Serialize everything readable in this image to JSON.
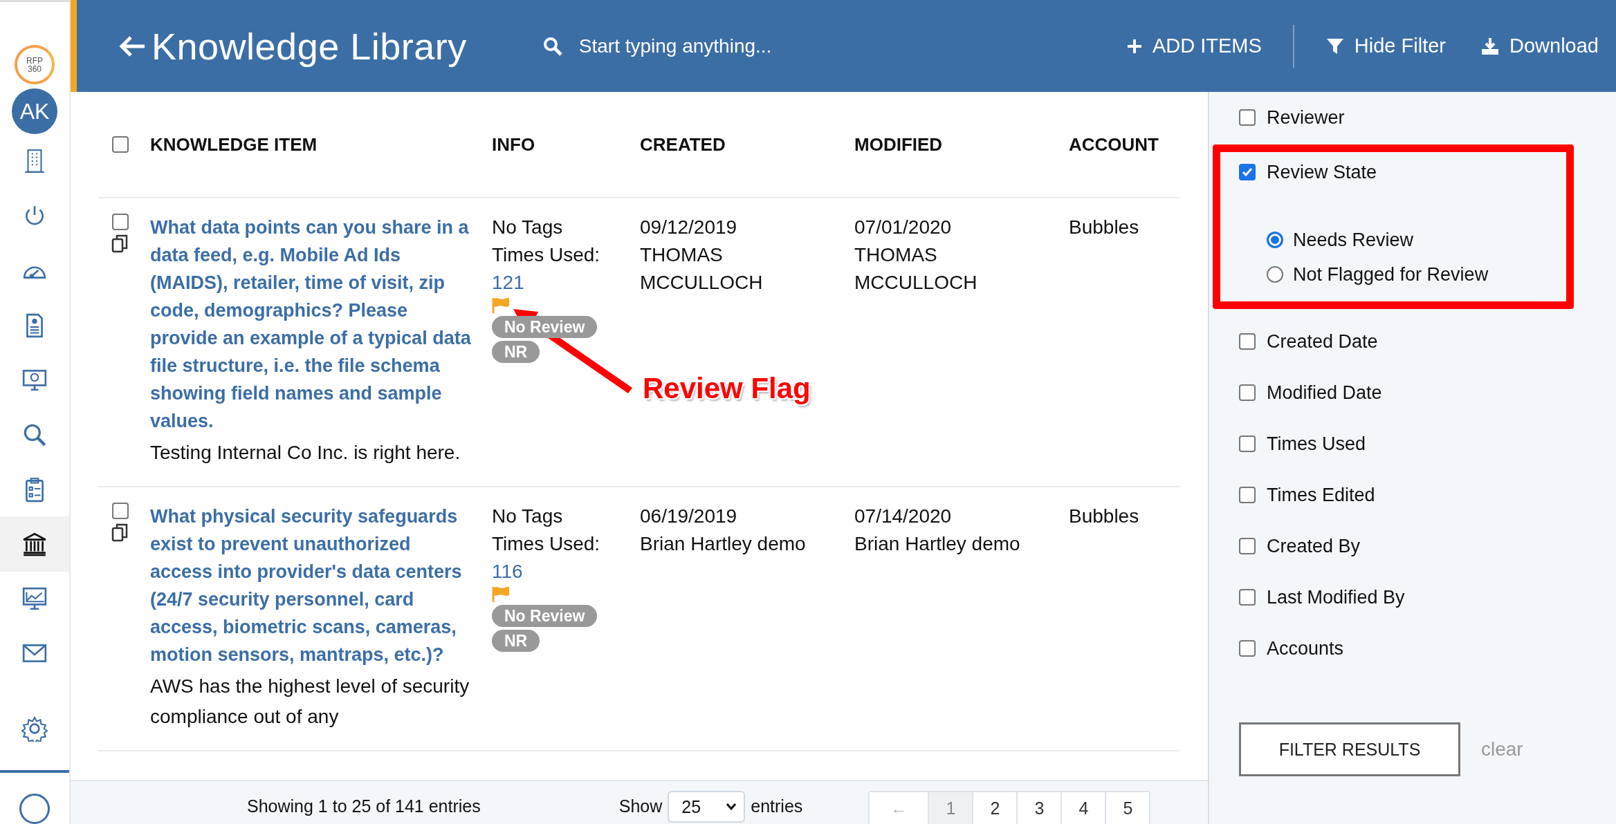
{
  "sidebar": {
    "logo": [
      "RFP",
      "360"
    ],
    "avatar": "AK",
    "items": [
      {
        "selected": false
      },
      {
        "selected": false
      },
      {
        "selected": false
      },
      {
        "selected": false
      },
      {
        "selected": false
      },
      {
        "selected": false
      },
      {
        "selected": false
      },
      {
        "selected": true
      },
      {
        "selected": false
      },
      {
        "selected": false
      },
      {
        "selected": false
      }
    ]
  },
  "header": {
    "title": "Knowledge Library",
    "search": {
      "placeholder": "Start typing anything..."
    },
    "actions": [
      {
        "kind": "add",
        "label": "ADD ITEMS"
      },
      {
        "kind": "filter",
        "label": "Hide Filter"
      },
      {
        "kind": "download",
        "label": "Download"
      }
    ]
  },
  "table": {
    "select_all_checked": false,
    "columns": [
      "KNOWLEDGE ITEM",
      "INFO",
      "CREATED",
      "MODIFIED",
      "ACCOUNT"
    ],
    "rows": [
      {
        "checked": false,
        "question": "What data points can you share in a data feed, e.g. Mobile Ad Ids (MAIDS), retailer, time of visit, zip code, demographics? Please provide an example of a typical data file structure, i.e. the file schema showing field names and sample values.",
        "answer": "Testing Internal Co Inc. is right here.",
        "info": {
          "tags": "No Tags",
          "times_used_label": "Times Used:",
          "times_used": "121",
          "flagged": true,
          "badges": [
            "No Review",
            "NR"
          ]
        },
        "created": {
          "date": "09/12/2019",
          "by": "THOMAS MCCULLOCH"
        },
        "modified": {
          "date": "07/01/2020",
          "by": "THOMAS MCCULLOCH"
        },
        "account": "Bubbles"
      },
      {
        "checked": false,
        "question": "What physical security safeguards exist to prevent unauthorized access into provider's data centers (24/7 security personnel, card access, biometric scans, cameras, motion sensors, mantraps, etc.)?",
        "answer": "AWS has the highest level of security compliance out of any",
        "info": {
          "tags": "No Tags",
          "times_used_label": "Times Used:",
          "times_used": "116",
          "flagged": true,
          "badges": [
            "No Review",
            "NR"
          ]
        },
        "created": {
          "date": "06/19/2019",
          "by": "Brian Hartley demo"
        },
        "modified": {
          "date": "07/14/2020",
          "by": "Brian Hartley demo"
        },
        "account": "Bubbles"
      }
    ]
  },
  "annotation": {
    "label": "Review Flag"
  },
  "pagination": {
    "summary": "Showing 1 to 25 of 141 entries",
    "show_label": "Show",
    "page_size": "25",
    "entries_label": "entries",
    "prev": {
      "label": "←",
      "disabled": true
    },
    "pages": [
      {
        "label": "1",
        "selected": true
      },
      {
        "label": "2",
        "selected": false
      },
      {
        "label": "3",
        "selected": false
      },
      {
        "label": "4",
        "selected": false
      },
      {
        "label": "5",
        "selected": false
      }
    ]
  },
  "filter": {
    "options": [
      {
        "label": "Reviewer",
        "checked": false
      },
      {
        "label": "Review State",
        "checked": true,
        "highlighted": true,
        "choices": [
          {
            "label": "Needs Review",
            "selected": true
          },
          {
            "label": "Not Flagged for Review",
            "selected": false
          }
        ]
      },
      {
        "label": "Created Date",
        "checked": false
      },
      {
        "label": "Modified Date",
        "checked": false
      },
      {
        "label": "Times Used",
        "checked": false
      },
      {
        "label": "Times Edited",
        "checked": false
      },
      {
        "label": "Created By",
        "checked": false
      },
      {
        "label": "Last Modified By",
        "checked": false
      },
      {
        "label": "Accounts",
        "checked": false
      }
    ],
    "apply": "FILTER RESULTS",
    "clear": "clear"
  }
}
